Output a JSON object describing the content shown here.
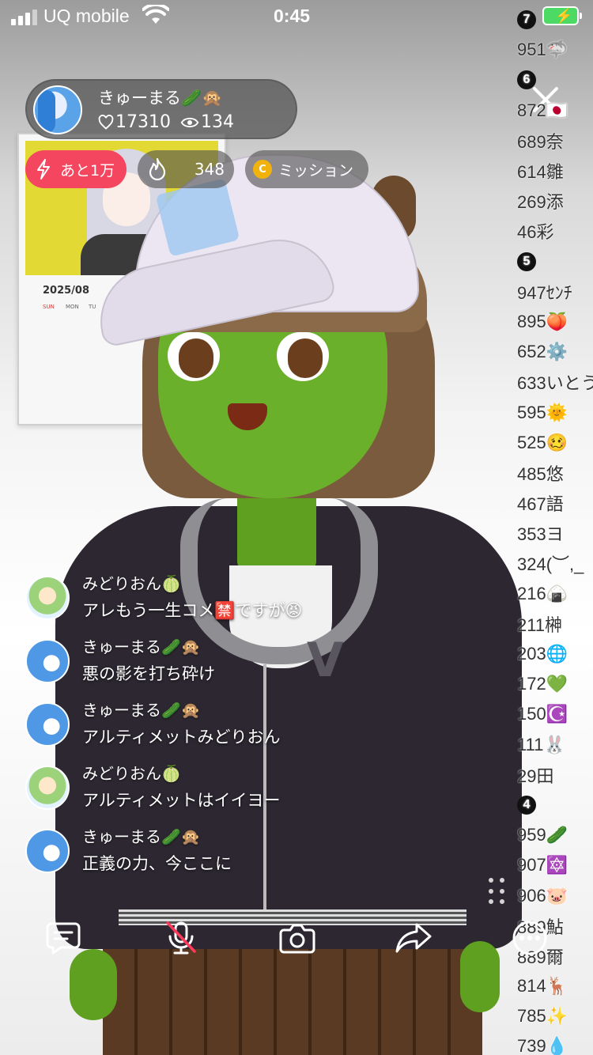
{
  "status_bar": {
    "carrier": "UQ mobile",
    "time": "0:45"
  },
  "host": {
    "name": "きゅーまる🥒🙊",
    "likes": "17310",
    "viewers": "134"
  },
  "chips": {
    "goal_label": "あと1万",
    "flame_value": "348",
    "mission_label": "ミッション",
    "coin_letter": "C"
  },
  "calendar": {
    "month": "2025/08",
    "weekdays": [
      "SUN",
      "MON",
      "TU"
    ]
  },
  "ranking": [
    {
      "type": "header",
      "label": "7"
    },
    {
      "type": "entry",
      "text": "951🦈"
    },
    {
      "type": "header",
      "label": "6"
    },
    {
      "type": "entry",
      "text": "872🇯🇵"
    },
    {
      "type": "entry",
      "text": "689奈"
    },
    {
      "type": "entry",
      "text": "614雛"
    },
    {
      "type": "entry",
      "text": "269添"
    },
    {
      "type": "entry",
      "text": "46彩"
    },
    {
      "type": "header",
      "label": "5"
    },
    {
      "type": "entry",
      "text": "947ｾﾝﾁ"
    },
    {
      "type": "entry",
      "text": "895🍑"
    },
    {
      "type": "entry",
      "text": "652⚙️"
    },
    {
      "type": "entry",
      "text": "633いとう"
    },
    {
      "type": "entry",
      "text": "595🌞"
    },
    {
      "type": "entry",
      "text": "525🥴"
    },
    {
      "type": "entry",
      "text": "485悠"
    },
    {
      "type": "entry",
      "text": "467語"
    },
    {
      "type": "entry",
      "text": "353ヨ"
    },
    {
      "type": "entry",
      "text": "324(︶,_"
    },
    {
      "type": "entry",
      "text": "216🍙"
    },
    {
      "type": "entry",
      "text": "211榊"
    },
    {
      "type": "entry",
      "text": "203🌐"
    },
    {
      "type": "entry",
      "text": "172💚"
    },
    {
      "type": "entry",
      "text": "150☪️"
    },
    {
      "type": "entry",
      "text": "111🐰"
    },
    {
      "type": "entry",
      "text": "29田"
    },
    {
      "type": "header",
      "label": "4"
    },
    {
      "type": "entry",
      "text": "959🥒"
    },
    {
      "type": "entry",
      "text": "907🔯"
    },
    {
      "type": "entry",
      "text": "906🐷"
    },
    {
      "type": "entry",
      "text": "889鮎"
    },
    {
      "type": "entry",
      "text": "889爾"
    },
    {
      "type": "entry",
      "text": "814🦌"
    },
    {
      "type": "entry",
      "text": "785✨"
    },
    {
      "type": "entry",
      "text": "739💧"
    }
  ],
  "comments": [
    {
      "name": "みどりおん🍈",
      "text": "アレもう一生コメ🈲ですが😡",
      "avatar": "green"
    },
    {
      "name": "きゅーまる🥒🙊",
      "text": "悪の影を打ち砕け",
      "avatar": "blue"
    },
    {
      "name": "きゅーまる🥒🙊",
      "text": "アルティメットみどりおん",
      "avatar": "blue"
    },
    {
      "name": "みどりおん🍈",
      "text": "アルティメットはイイヨー",
      "avatar": "green"
    },
    {
      "name": "きゅーまる🥒🙊",
      "text": "正義の力、今ここに",
      "avatar": "blue"
    }
  ],
  "toolbar": {
    "icons": [
      "comment-icon",
      "mic-muted-icon",
      "camera-icon",
      "share-icon",
      "more-icon"
    ]
  },
  "colors": {
    "goal_chip": "#f5465f",
    "overlay": "#505050",
    "coin": "#f2b20e",
    "battery": "#4cd964"
  }
}
